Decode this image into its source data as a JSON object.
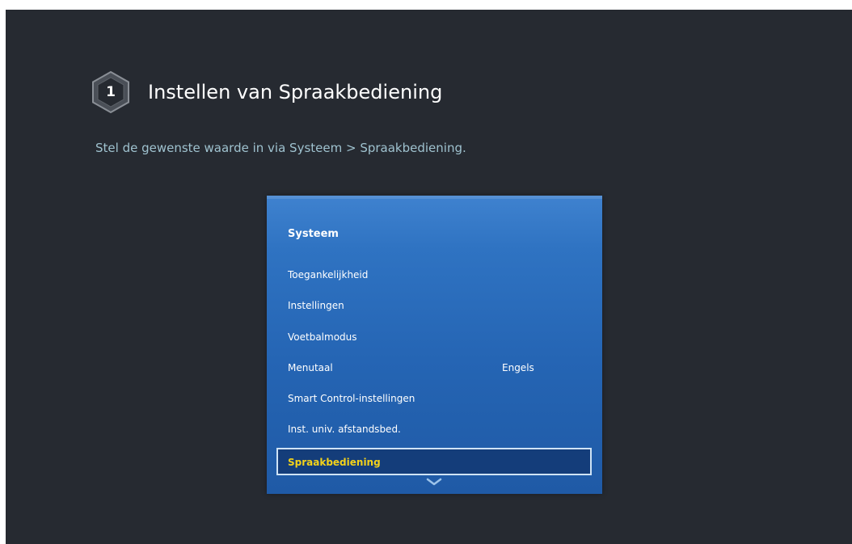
{
  "header": {
    "step_number": "1",
    "title": "Instellen van Spraakbediening",
    "subtitle": "Stel de gewenste waarde in via Systeem > Spraakbediening."
  },
  "menu": {
    "heading": "Systeem",
    "items": [
      {
        "label": "Toegankelijkheid",
        "value": ""
      },
      {
        "label": "Instellingen",
        "value": ""
      },
      {
        "label": "Voetbalmodus",
        "value": ""
      },
      {
        "label": "Menutaal",
        "value": "Engels"
      },
      {
        "label": "Smart Control-instellingen",
        "value": ""
      },
      {
        "label": "Inst. univ. afstandsbed.",
        "value": ""
      },
      {
        "label": "Spraakbediening",
        "value": "",
        "selected": true
      }
    ],
    "scroll_icon": "chevron-down-icon"
  },
  "colors": {
    "background": "#262a31",
    "panel": "#2565b4",
    "selected_text": "#f3d21a",
    "subtitle": "#9fc2cf"
  }
}
